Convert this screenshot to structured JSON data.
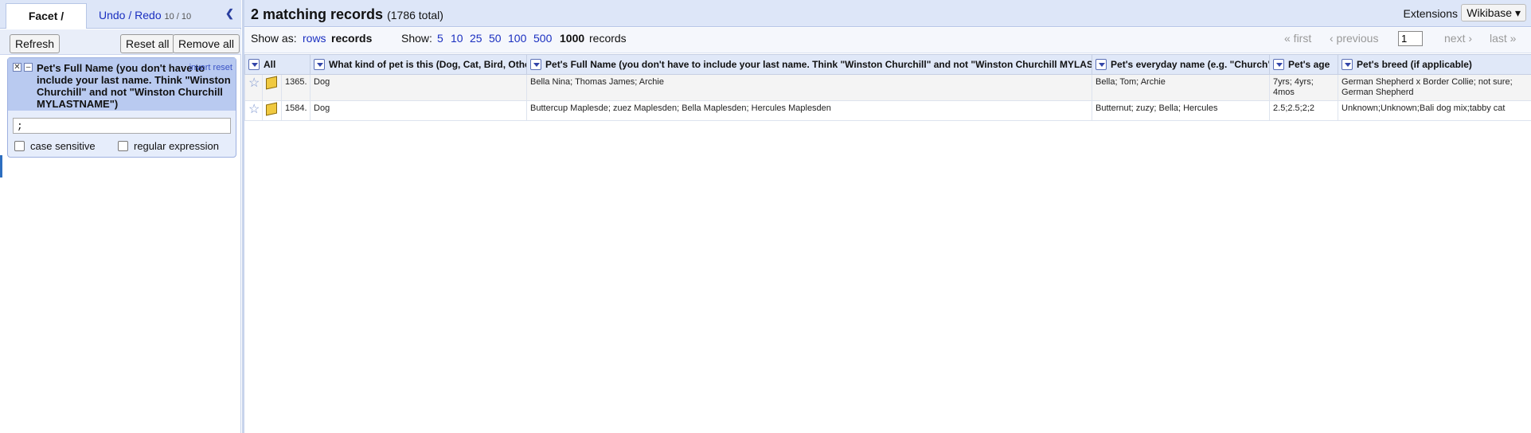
{
  "left_panel": {
    "tabs": [
      {
        "label": "Facet / Filter"
      },
      {
        "label": "Undo / Redo",
        "count": "10 / 10"
      }
    ],
    "buttons": {
      "refresh": "Refresh",
      "reset_all": "Reset all",
      "remove_all": "Remove all"
    },
    "facet": {
      "title": "Pet's Full Name (you don't have to include your last name. Think \"Winston Churchill\" and not \"Winston Churchill MYLASTNAME\")",
      "invert": "invert",
      "reset": "reset",
      "query": ";",
      "case_sensitive": "case sensitive",
      "regex": "regular expression"
    }
  },
  "header": {
    "count": "2 matching records",
    "total": "(1786 total)",
    "extensions": "Extensions",
    "wikibase": "Wikibase ▾"
  },
  "viewbar": {
    "show_as": "Show as:",
    "rows": "rows",
    "records": "records",
    "show": "Show:",
    "sizes": [
      "5",
      "10",
      "25",
      "50",
      "100",
      "500",
      "1000"
    ],
    "records_suffix": "records",
    "first": "« first",
    "previous": "‹ previous",
    "page": "1",
    "next": "next ›",
    "last": "last »"
  },
  "table": {
    "columns": [
      "All",
      "What kind of pet is this (Dog, Cat, Bird, Other)",
      "Pet's Full Name (you don't have to include your last name. Think \"Winston Churchill\" and not \"Winston Churchill MYLASTNAME\")",
      "Pet's everyday name (e.g. \"Church\")",
      "Pet's age",
      "Pet's breed (if applicable)"
    ],
    "rows": [
      {
        "num": "1365.",
        "kind": "Dog",
        "full_name": "Bella Nina; Thomas James; Archie",
        "everyday": "Bella; Tom; Archie",
        "age": "7yrs; 4yrs; 4mos",
        "breed": "German Shepherd x Border Collie; not sure; German Shepherd"
      },
      {
        "num": "1584.",
        "kind": "Dog",
        "full_name": "Buttercup Maplesde; zuez Maplesden; Bella Maplesden; Hercules Maplesden",
        "everyday": "Butternut; zuzy; Bella; Hercules",
        "age": "2.5;2.5;2;2",
        "breed": "Unknown;Unknown;Bali dog mix;tabby cat"
      }
    ]
  },
  "colors": {
    "accent": "#1a2fc0",
    "header_bg": "#dde6f8",
    "facet_head": "#b9caf0"
  }
}
